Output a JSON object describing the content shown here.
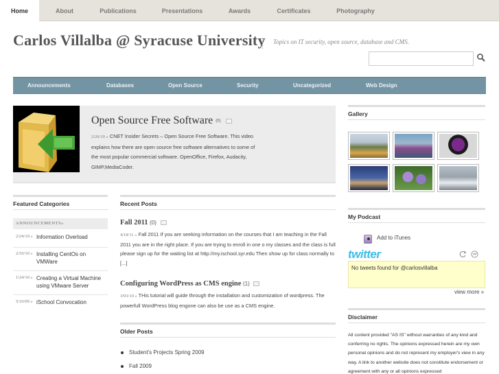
{
  "nav": {
    "items": [
      "Home",
      "About",
      "Publications",
      "Presentations",
      "Awards",
      "Certificates",
      "Photography"
    ]
  },
  "header": {
    "title": "Carlos Villalba @ Syracuse University",
    "tagline": "Topics on IT security, open source, database and CMS.",
    "search_placeholder": "",
    "search_icon": "magnifier-icon"
  },
  "categories": [
    "Announcements",
    "Databases",
    "Open Source",
    "Security",
    "Uncategorized",
    "Web Design"
  ],
  "featured": {
    "title": "Open Source Free Software",
    "comment_count": "(0)",
    "date": "2/26/10 »",
    "excerpt": "CNET Insider Secrets – Open Source Free Software. This video explains how there are open source free software alternatives to some of the most popular commercial software. OpenOffice, Firefox, Audacity, GIMP,MediaCoder."
  },
  "featured_categories": {
    "heading": "Featured Categories",
    "category": "ANNOUNCEMENTS»",
    "items": [
      {
        "date": "2/24/10 »",
        "title": "Information Overload"
      },
      {
        "date": "2/10/10 »",
        "title": "Installing CentOs on VMWare"
      },
      {
        "date": "1/24/10 »",
        "title": "Creating a Virtual Machine using VMware Server"
      },
      {
        "date": "5/10/09 »",
        "title": "iSchool Convocation"
      }
    ]
  },
  "recent_posts": {
    "heading": "Recent Posts",
    "posts": [
      {
        "title": "Fall 2011",
        "count": "(0)",
        "date": "4/18/11 »",
        "excerpt": "Fall 2011 If you are seeking information on the courses that I am teaching in the Fall 2011 you are in the right place. If you are trying to enroll in one o my classes and the class is full please sign up for the waiting list at http://my.ischool.syr.edu Then show up for class normally to [...]"
      },
      {
        "title": "Configuring WordPress as CMS engine",
        "count": "(1)",
        "date": "3/03/10 »",
        "excerpt": "THis tutorial will guide through the installation and customization of wordpress. The powerfull WordPress blog engone can also be use as a CMS engine."
      }
    ]
  },
  "older_posts": {
    "heading": "Older Posts",
    "items": [
      "Student's Projects Spring 2009",
      "Fall 2009"
    ]
  },
  "gallery": {
    "heading": "Gallery"
  },
  "podcast": {
    "heading": "My Podcast",
    "itunes_label": "Add to iTunes"
  },
  "twitter": {
    "logo": "twitter",
    "message": "No tweets found for @carlosvillalba",
    "view_more": "view more »"
  },
  "disclaimer": {
    "heading": "Disclaimer",
    "text": "All content provided \"AS IS\" without warranties of any kind and conferring no rights. The opinions expressed herein are my own personal opinions and do not represent my employer's view in any way. A link to another website does not constitute endorsement or agreement with any or all opinions expressed"
  },
  "colors": {
    "category_bar": "#7394a3",
    "top_nav": "#e6e3dc",
    "featured_bg": "#ececec",
    "tweet_bg": "#ffffcc",
    "twitter_blue": "#3fbde6"
  }
}
